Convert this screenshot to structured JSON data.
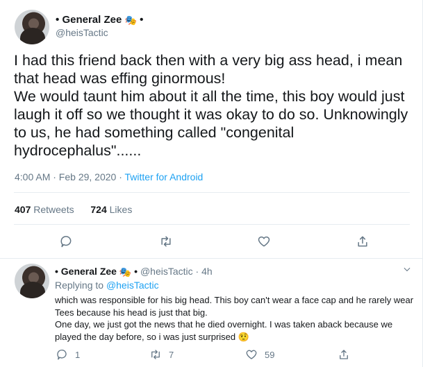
{
  "tweet": {
    "author_name": "General Zee",
    "name_prefix": "•",
    "name_suffix": "•",
    "author_emoji": "🎭",
    "handle": "@heisTactic",
    "text": "I had this friend back then with a very big ass head, i mean that head was effing ginormous!\nWe would taunt him about it all the time, this boy would just laugh it off so we thought it was okay to do so. Unknowingly to us, he had something called \"congenital hydrocephalus\"......",
    "time": "4:00 AM · Feb 29, 2020 · ",
    "source": "Twitter for Android",
    "retweet_count": "407",
    "retweets_label": "Retweets",
    "like_count": "724",
    "likes_label": "Likes",
    "actions": [
      "reply-icon",
      "retweet-icon",
      "like-icon",
      "share-icon"
    ]
  },
  "reply": {
    "author_name": "General Zee",
    "name_prefix": "•",
    "name_suffix": "•",
    "author_emoji": "🎭",
    "handle": "@heisTactic",
    "time": "4h",
    "separator": "·",
    "replying_label": "Replying to",
    "replying_handle": "@heisTactic",
    "text": "which was responsible for his big head. This boy can't wear a face cap and he rarely wear Tees because his head is just that big.\nOne day, we just got the news that he died overnight. I was taken aback because we played the day before, so i was just surprised 🤨",
    "reply_count": "1",
    "retweet_count": "7",
    "like_count": "59"
  }
}
